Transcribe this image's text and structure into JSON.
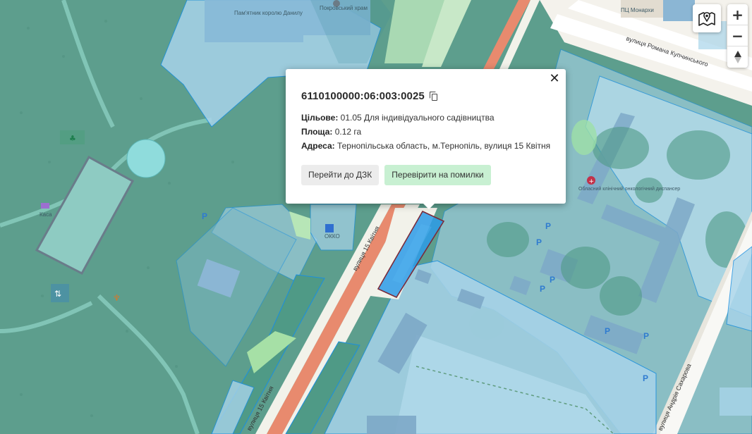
{
  "map": {
    "labels": {
      "monument": "Пам'ятник королю Данилу",
      "church": "Покровський храм",
      "kasa": "Каса",
      "okko": "ОККО",
      "hospital": "Обласний клінічний онкологічний диспансер",
      "pu": "ПЦ Монархи",
      "street_kupchynskoho": "вулиця Романа Купчинського",
      "street_15_kvitnia_1": "вулиця 15 Квітня",
      "street_15_kvitnia_2": "вулиця 15 Квітня",
      "street_sakharova": "вулиця Андрія Сахарова",
      "parking": "P"
    },
    "colors": {
      "forest": "#5d9e8d",
      "cadastre_fill": "#a8d4ea",
      "cadastre_stroke": "#1a8fe0",
      "selected_fill": "#2d9be8",
      "selected_stroke": "#7a2b3a",
      "road_main": "#e88a6e"
    }
  },
  "popup": {
    "cadastral_number": "6110100000:06:003:0025",
    "purpose_label": "Цільове:",
    "purpose_value": "01.05 Для індивідуального садівництва",
    "area_label": "Площа:",
    "area_value": "0.12 га",
    "address_label": "Адреса:",
    "address_value": "Тернопільська область, м.Тернопіль, вулиця 15 Квітня",
    "btn_dzk": "Перейти до ДЗК",
    "btn_check": "Перевірити на помилки",
    "close_symbol": "✕"
  },
  "controls": {
    "zoom_in": "+",
    "zoom_out": "−"
  }
}
